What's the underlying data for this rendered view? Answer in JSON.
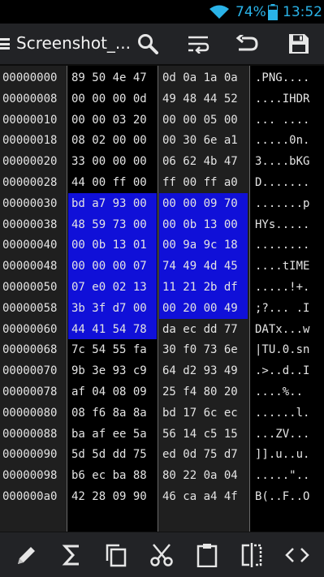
{
  "status_bar": {
    "battery_percent": "74%",
    "time": "13:52"
  },
  "action_bar": {
    "title": "Screenshot_...",
    "icons": [
      "menu-icon",
      "search-icon",
      "word-wrap-icon",
      "undo-icon",
      "save-icon"
    ]
  },
  "hex_rows": [
    {
      "offset": "00000000",
      "g1": "89 50 4e 47",
      "g2": "0d 0a 1a 0a",
      "ascii": ".PNG...."
    },
    {
      "offset": "00000008",
      "g1": "00 00 00 0d",
      "g2": "49 48 44 52",
      "ascii": "....IHDR"
    },
    {
      "offset": "00000010",
      "g1": "00 00 03 20",
      "g2": "00 00 05 00",
      "ascii": "... ...."
    },
    {
      "offset": "00000018",
      "g1": "08 02 00 00",
      "g2": "00 30 6e a1",
      "ascii": ".....0n."
    },
    {
      "offset": "00000020",
      "g1": "33 00 00 00",
      "g2": "06 62 4b 47",
      "ascii": "3....bKG"
    },
    {
      "offset": "00000028",
      "g1": "44 00 ff 00",
      "g2": "ff 00 ff a0",
      "ascii": "D......."
    },
    {
      "offset": "00000030",
      "g1": "bd a7 93 00",
      "g2": "00 00 09 70",
      "ascii": ".......p"
    },
    {
      "offset": "00000038",
      "g1": "48 59 73 00",
      "g2": "00 0b 13 00",
      "ascii": "HYs....."
    },
    {
      "offset": "00000040",
      "g1": "00 0b 13 01",
      "g2": "00 9a 9c 18",
      "ascii": "........"
    },
    {
      "offset": "00000048",
      "g1": "00 00 00 07",
      "g2": "74 49 4d 45",
      "ascii": "....tIME"
    },
    {
      "offset": "00000050",
      "g1": "07 e0 02 13",
      "g2": "11 21 2b df",
      "ascii": ".....!+."
    },
    {
      "offset": "00000058",
      "g1": "3b 3f d7 00",
      "g2": "00 20 00 49",
      "ascii": ";?... .I"
    },
    {
      "offset": "00000060",
      "g1": "44 41 54 78",
      "g2": "da ec dd 77",
      "ascii": "DATx...w"
    },
    {
      "offset": "00000068",
      "g1": "7c 54 55 fa",
      "g2": "30 f0 73 6e",
      "ascii": "|TU.0.sn"
    },
    {
      "offset": "00000070",
      "g1": "9b 3e 93 c9",
      "g2": "64 d2 93 49",
      "ascii": ".>..d..I"
    },
    {
      "offset": "00000078",
      "g1": "af 04 08 09",
      "g2": "25 f4 80 20",
      "ascii": "....%.. "
    },
    {
      "offset": "00000080",
      "g1": "08 f6 8a 8a",
      "g2": "bd 17 6c ec",
      "ascii": "......l."
    },
    {
      "offset": "00000088",
      "g1": "ba af ee 5a",
      "g2": "56 14 c5 15",
      "ascii": "...ZV..."
    },
    {
      "offset": "00000090",
      "g1": "5d 5d dd 75",
      "g2": "ed 0d 75 d7",
      "ascii": "]].u..u."
    },
    {
      "offset": "00000098",
      "g1": "b6 ec ba 88",
      "g2": "80 22 0a 04",
      "ascii": ".....\".."
    },
    {
      "offset": "000000a0",
      "g1": "42 28 09 90",
      "g2": "46 ca a4 4f",
      "ascii": "B(..F..O"
    }
  ],
  "selection": {
    "start_offset": "00000030",
    "end_offset": "00000063"
  },
  "colors": {
    "selection": "#1010d8",
    "accent": "#2ab3e8",
    "bar": "#222326"
  },
  "bottom_bar": {
    "icons": [
      "pencil-icon",
      "sum-icon",
      "copy-icon",
      "cut-icon",
      "paste-icon",
      "split-view-icon",
      "code-icon"
    ]
  }
}
